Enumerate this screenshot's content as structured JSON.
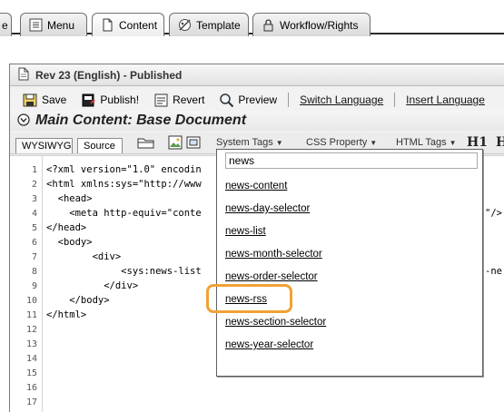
{
  "top_tabs": [
    {
      "label": "e",
      "icon": "partial-tab"
    },
    {
      "label": "Menu",
      "icon": "menu-icon"
    },
    {
      "label": "Content",
      "icon": "document-icon"
    },
    {
      "label": "Template",
      "icon": "template-icon"
    },
    {
      "label": "Workflow/Rights",
      "icon": "workflow-lock-icon"
    }
  ],
  "window": {
    "title": "Rev 23 (English) - Published"
  },
  "toolbar": {
    "save": "Save",
    "publish": "Publish!",
    "revert": "Revert",
    "preview": "Preview",
    "switch_language": "Switch Language",
    "insert_language": "Insert Language"
  },
  "section": {
    "title": "Main Content: Base Document"
  },
  "editor": {
    "tab_wysiwyg": "WYSIWYG",
    "tab_source": "Source",
    "system_tags": "System Tags",
    "css_property": "CSS Property",
    "html_tags": "HTML Tags",
    "h1": "H1",
    "h2_partial": "H"
  },
  "code_lines": [
    {
      "n": "1",
      "text": "<?xml version=\"1.0\" encodin"
    },
    {
      "n": "2",
      "text": "<html xmlns:sys=\"http://www"
    },
    {
      "n": "3",
      "text": "  <head>"
    },
    {
      "n": "4",
      "text": "    <meta http-equiv=\"conte"
    },
    {
      "n": "5",
      "text": "</head>"
    },
    {
      "n": "6",
      "text": "  <body>"
    },
    {
      "n": "7",
      "text": "        <div>"
    },
    {
      "n": "8",
      "text": "             <sys:news-list"
    },
    {
      "n": "9",
      "text": "          </div>"
    },
    {
      "n": "10",
      "text": "    </body>"
    },
    {
      "n": "11",
      "text": "</html>"
    },
    {
      "n": "12",
      "text": ""
    },
    {
      "n": "13",
      "text": ""
    },
    {
      "n": "14",
      "text": ""
    },
    {
      "n": "15",
      "text": ""
    },
    {
      "n": "16",
      "text": ""
    },
    {
      "n": "17",
      "text": ""
    }
  ],
  "code_overflow": {
    "line4_tail": "\"/>",
    "line8_tail": "-ne"
  },
  "tag_popup": {
    "filter_value": "news",
    "options": [
      "news-content",
      "news-day-selector",
      "news-list",
      "news-month-selector",
      "news-order-selector",
      "news-rss",
      "news-section-selector",
      "news-year-selector"
    ],
    "highlighted_option": "news-rss"
  },
  "colors": {
    "highlight_ring": "#f0a236",
    "tab_border": "#6e6e6e"
  }
}
